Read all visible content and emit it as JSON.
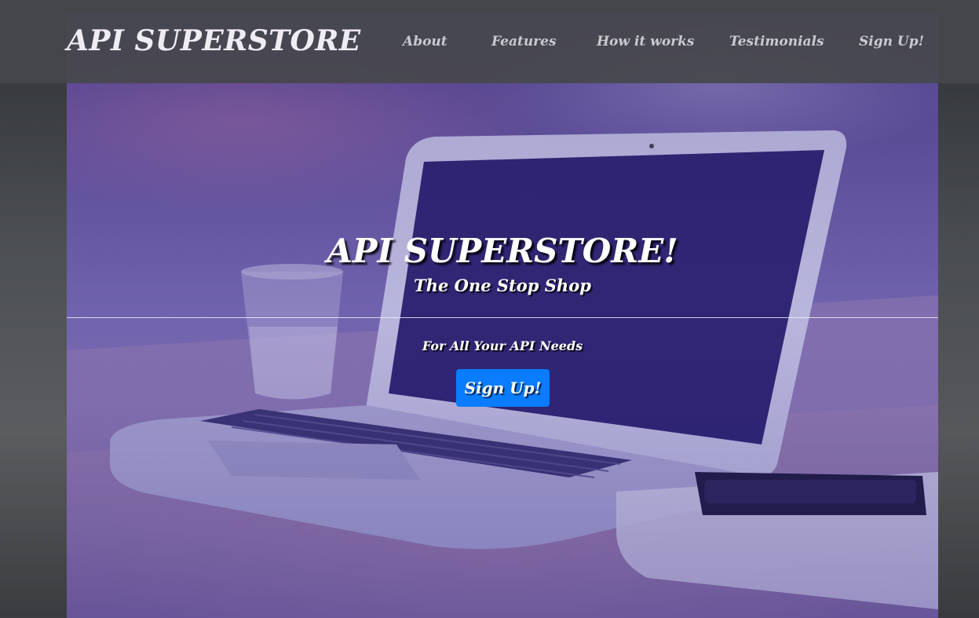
{
  "brand": {
    "name": "API SUPERSTORE"
  },
  "nav": {
    "items": [
      {
        "label": "About"
      },
      {
        "label": "Features"
      },
      {
        "label": "How it works"
      },
      {
        "label": "Testimonials"
      },
      {
        "label": "Sign Up!"
      }
    ]
  },
  "hero": {
    "title": "API SUPERSTORE!",
    "subtitle": "The One Stop Shop",
    "tagline": "For All Your API Needs",
    "cta_label": "Sign Up!"
  },
  "colors": {
    "navbar": "#46484c",
    "nav_text": "#c9c9cf",
    "brand_text": "#f0ecf4",
    "cta": "#0a7cff",
    "hero_tint": "#5b4a8c"
  }
}
